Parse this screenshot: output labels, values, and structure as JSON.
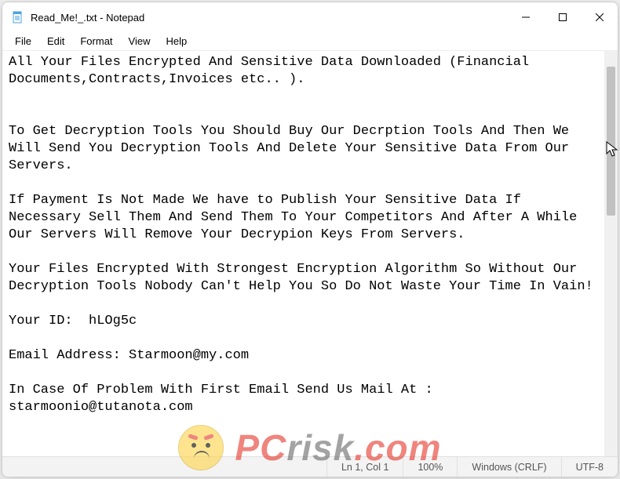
{
  "window": {
    "title": "Read_Me!_.txt - Notepad"
  },
  "menu": {
    "file": "File",
    "edit": "Edit",
    "format": "Format",
    "view": "View",
    "help": "Help"
  },
  "document_text": "All Your Files Encrypted And Sensitive Data Downloaded (Financial Documents,Contracts,Invoices etc.. ).\n\n\nTo Get Decryption Tools You Should Buy Our Decrption Tools And Then We Will Send You Decryption Tools And Delete Your Sensitive Data From Our Servers.\n\nIf Payment Is Not Made We have to Publish Your Sensitive Data If Necessary Sell Them And Send Them To Your Competitors And After A While Our Servers Will Remove Your Decrypion Keys From Servers.\n\nYour Files Encrypted With Strongest Encryption Algorithm So Without Our Decryption Tools Nobody Can't Help You So Do Not Waste Your Time In Vain!\n\nYour ID:  hLOg5c\n\nEmail Address: Starmoon@my.com\n\nIn Case Of Problem With First Email Send Us Mail At : starmoonio@tutanota.com",
  "statusbar": {
    "position": "Ln 1, Col 1",
    "zoom": "100%",
    "line_ending": "Windows (CRLF)",
    "encoding": "UTF-8"
  },
  "watermark": {
    "brand_part1": "PC",
    "brand_part2": "risk",
    "brand_part3": ".com"
  }
}
